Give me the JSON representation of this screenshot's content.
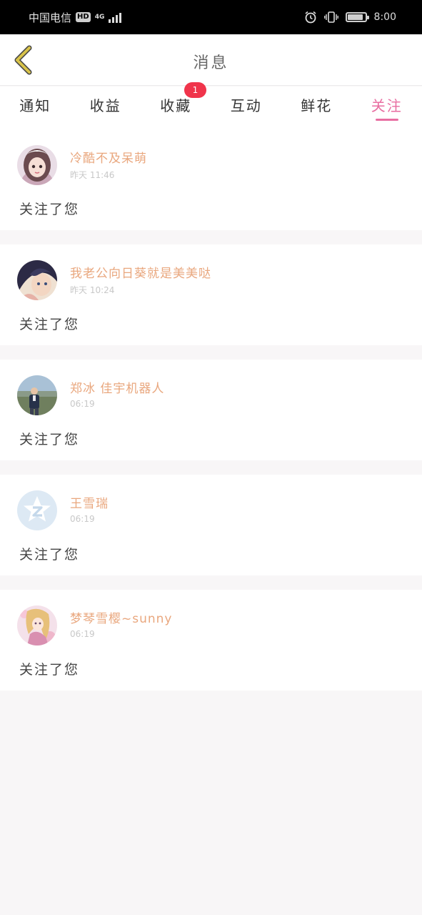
{
  "status_bar": {
    "carrier": "中国电信",
    "hd": "HD",
    "network": "4G",
    "time": "8:00",
    "battery_level": 0.9
  },
  "header": {
    "title": "消息",
    "back_icon": "chevron-left-icon"
  },
  "tabs": [
    {
      "label": "通知",
      "active": false
    },
    {
      "label": "收益",
      "active": false
    },
    {
      "label": "收藏",
      "active": false,
      "badge": "1"
    },
    {
      "label": "互动",
      "active": false
    },
    {
      "label": "鲜花",
      "active": false
    },
    {
      "label": "关注",
      "active": true
    }
  ],
  "notifications": [
    {
      "username": "冷酷不及呆萌",
      "time": "昨天 11:46",
      "action": "关注了您",
      "avatar": "avatar-anime-girl"
    },
    {
      "username": "我老公向日葵就是美美哒",
      "time": "昨天 10:24",
      "action": "关注了您",
      "avatar": "avatar-anime-dark-hair"
    },
    {
      "username": "郑冰 佳宇机器人",
      "time": "06:19",
      "action": "关注了您",
      "avatar": "avatar-man-photo"
    },
    {
      "username": "王雪瑞",
      "time": "06:19",
      "action": "关注了您",
      "avatar": "avatar-default-star"
    },
    {
      "username": "梦琴雪樱~sunny",
      "time": "06:19",
      "action": "关注了您",
      "avatar": "avatar-anime-pink"
    }
  ],
  "colors": {
    "accent": "#e86ea1",
    "username": "#e9a77e",
    "badge": "#f0344b",
    "back_chevron": "#d8c34a"
  }
}
